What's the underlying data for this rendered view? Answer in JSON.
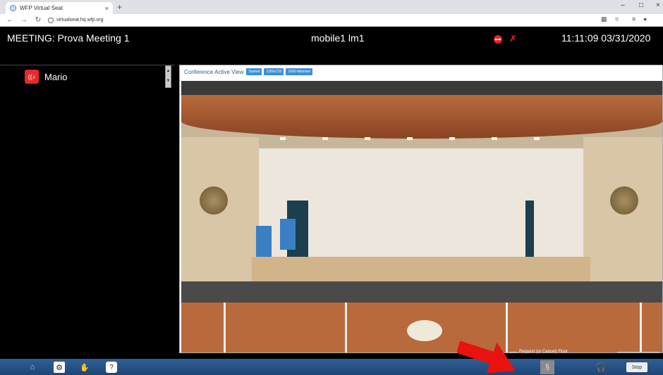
{
  "browser": {
    "tab_title": "WFP Virtual Seat",
    "tab_close": "×",
    "new_tab": "+",
    "url": "virtualseat.hq.wfp.org",
    "window_controls": [
      "–",
      "□",
      "×"
    ]
  },
  "header": {
    "meeting_title": "MEETING: Prova Meeting 1",
    "current_user": "mobile1 lm1",
    "clock": "11:11:09 03/31/2020"
  },
  "participants": [
    {
      "name": "Mario"
    }
  ],
  "video": {
    "label": "Conference Active View",
    "badges": [
      "Started",
      "1280x720",
      "1600 kbits/sec"
    ]
  },
  "floor": {
    "label": "Request (or Cancel) Floor"
  },
  "toolbar": {
    "stop_label": "Stop"
  },
  "colors": {
    "toolbar_blue": "#1e4677",
    "accent_red": "#e52a2a",
    "badge_blue": "#3b8fd8"
  },
  "icons": {
    "home": "home-icon",
    "settings": "gear-icon",
    "raise_hand": "raise-hand-icon",
    "help": "help-icon",
    "floor_request": "floor-request-icon",
    "headset": "headset-icon",
    "stop_meeting": "stop-icon",
    "mic_muted": "mic-muted-icon"
  }
}
